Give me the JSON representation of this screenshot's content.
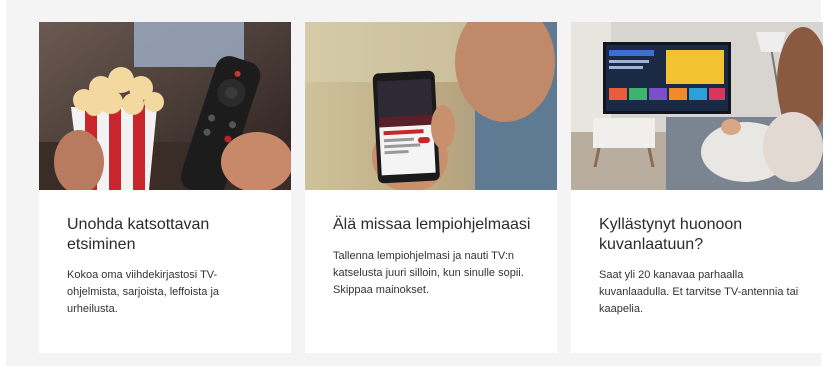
{
  "cards": [
    {
      "title": "Unohda katsottavan etsiminen",
      "text": "Kokoa oma viihdekirjastosi TV-ohjelmista, sarjoista, leffoista ja urheilusta."
    },
    {
      "title": "Älä missaa lempiohjelmaasi",
      "text": "Tallenna lempiohjelmasi ja nauti TV:n katselusta juuri silloin, kun sinulle sopii. Skippaa mainokset."
    },
    {
      "title": "Kyllästynyt huonoon kuvanlaatuun?",
      "text": "Saat yli 20 kanavaa parhaalla kuvanlaadulla. Et tarvitse TV-antennia tai kaapelia."
    }
  ],
  "colors": {
    "section_bg": "#f4f4f4",
    "card_bg": "#ffffff",
    "title": "#2b2b2b",
    "text": "#333333"
  }
}
